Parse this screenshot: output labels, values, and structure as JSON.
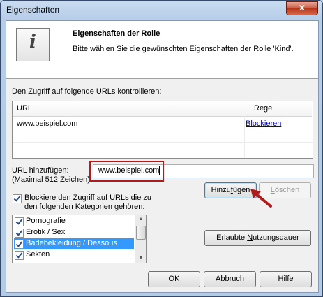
{
  "window": {
    "title": "Eigenschaften",
    "close_label": "x"
  },
  "header": {
    "icon_letter": "i",
    "title": "Eigenschaften der Rolle",
    "subtitle": "Bitte wählen Sie die gewünschten Eigenschaften der Rolle 'Kind'."
  },
  "urls": {
    "label": "Den Zugriff auf folgende URLs kontrollieren:",
    "columns": [
      "URL",
      "Regel"
    ],
    "rows": [
      {
        "url": "www.beispiel.com",
        "rule": "Blockieren"
      }
    ]
  },
  "add_url": {
    "label_line1": "URL hinzufügen:",
    "label_line2": "(Maximal 512 Zeichen)",
    "value": "www.beispiel.com",
    "add_button": "Hinzufügen",
    "add_button_pre": "Hinzu",
    "add_button_accel": "f",
    "add_button_post": "ügen",
    "delete_button": "Löschen",
    "delete_button_accel": "L",
    "delete_button_post": "öschen"
  },
  "categories": {
    "checkbox_line1": "Blockiere den Zugriff auf URLs die zu",
    "checkbox_line2": "den folgenden Kategorien gehören:",
    "checked": true,
    "items": [
      {
        "label": "Pornografie",
        "checked": true,
        "selected": false
      },
      {
        "label": "Erotik / Sex",
        "checked": true,
        "selected": false
      },
      {
        "label": "Badebekleidung / Dessous",
        "checked": true,
        "selected": true
      },
      {
        "label": "Sekten",
        "checked": true,
        "selected": false
      }
    ]
  },
  "buttons": {
    "usage_pre": "Erlaubte ",
    "usage_accel": "N",
    "usage_post": "utzungsdauer",
    "ok_accel": "O",
    "ok_post": "K",
    "cancel_accel": "A",
    "cancel_post": "bbruch",
    "help_accel": "H",
    "help_post": "ilfe"
  }
}
